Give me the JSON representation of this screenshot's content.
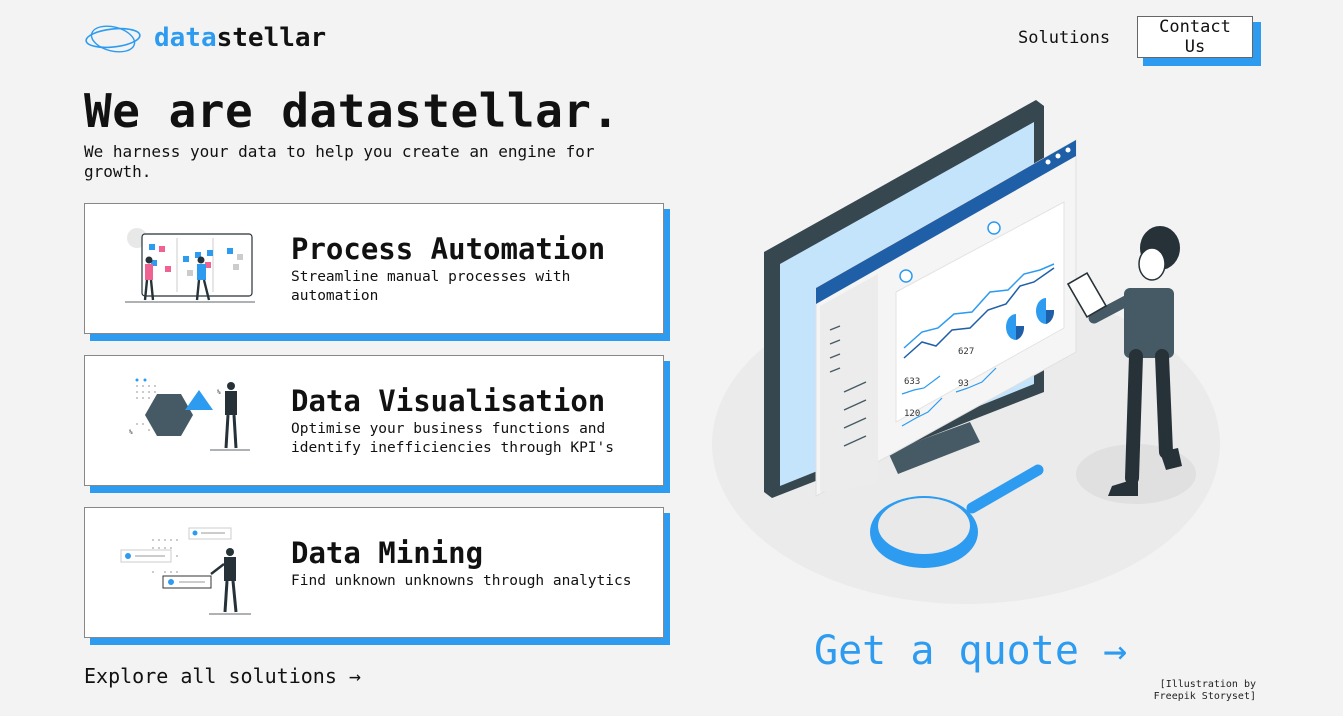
{
  "header": {
    "logo_part1": "data",
    "logo_part2": "stellar",
    "nav_solutions": "Solutions",
    "contact_label": "Contact Us"
  },
  "hero": {
    "title": "We are datastellar.",
    "subtitle": "We harness your data to help you create an engine for growth."
  },
  "services": [
    {
      "title": "Process Automation",
      "description": "Streamline manual processes with automation",
      "illustration": "kanban-board-illustration"
    },
    {
      "title": "Data Visualisation",
      "description": "Optimise your business functions and identify inefficiencies through KPI's",
      "illustration": "hexagon-chart-illustration"
    },
    {
      "title": "Data Mining",
      "description": "Find unknown unknowns through analytics",
      "illustration": "data-points-illustration"
    }
  ],
  "explore_label": "Explore all solutions →",
  "quote_label": "Get a quote →",
  "credit": "[Illustration by Freepik Storyset]",
  "dashboard_numbers": [
    "627",
    "633",
    "93",
    "120"
  ],
  "colors": {
    "accent": "#2d9bf0",
    "background": "#f3f3f3",
    "text": "#111111",
    "dark_figure": "#37474f"
  }
}
